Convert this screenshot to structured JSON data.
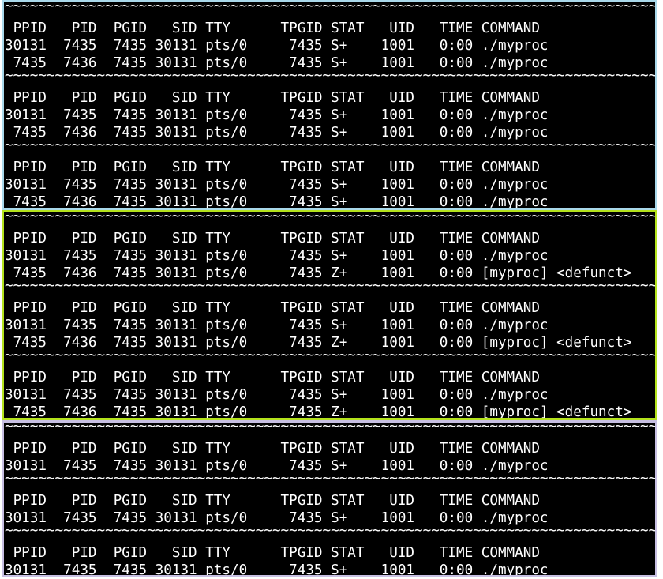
{
  "panels": [
    {
      "name": "running-group",
      "border_color": "#a9d8ea",
      "lines": [
        "~~~~~~~~~~~~~~~~~~~~~~~~~~~~~~~~~~~~~~~~~~~~~~~~~~~~~~~~~~~~~~~~~~~~~~~~~~~~~~~~~",
        " PPID   PID  PGID   SID TTY      TPGID STAT   UID   TIME COMMAND",
        "30131  7435  7435 30131 pts/0     7435 S+    1001   0:00 ./myproc",
        " 7435  7436  7435 30131 pts/0     7435 S+    1001   0:00 ./myproc",
        "~~~~~~~~~~~~~~~~~~~~~~~~~~~~~~~~~~~~~~~~~~~~~~~~~~~~~~~~~~~~~~~~~~~~~~~~~~~~~~~~~",
        " PPID   PID  PGID   SID TTY      TPGID STAT   UID   TIME COMMAND",
        "30131  7435  7435 30131 pts/0     7435 S+    1001   0:00 ./myproc",
        " 7435  7436  7435 30131 pts/0     7435 S+    1001   0:00 ./myproc",
        "~~~~~~~~~~~~~~~~~~~~~~~~~~~~~~~~~~~~~~~~~~~~~~~~~~~~~~~~~~~~~~~~~~~~~~~~~~~~~~~~~",
        " PPID   PID  PGID   SID TTY      TPGID STAT   UID   TIME COMMAND",
        "30131  7435  7435 30131 pts/0     7435 S+    1001   0:00 ./myproc",
        " 7435  7436  7435 30131 pts/0     7435 S+    1001   0:00 ./myproc"
      ]
    },
    {
      "name": "zombie-group",
      "border_color": "#b4e21c",
      "lines": [
        "~~~~~~~~~~~~~~~~~~~~~~~~~~~~~~~~~~~~~~~~~~~~~~~~~~~~~~~~~~~~~~~~~~~~~~~~~~~~~~~~~",
        " PPID   PID  PGID   SID TTY      TPGID STAT   UID   TIME COMMAND",
        "30131  7435  7435 30131 pts/0     7435 S+    1001   0:00 ./myproc",
        " 7435  7436  7435 30131 pts/0     7435 Z+    1001   0:00 [myproc] <defunct>",
        "~~~~~~~~~~~~~~~~~~~~~~~~~~~~~~~~~~~~~~~~~~~~~~~~~~~~~~~~~~~~~~~~~~~~~~~~~~~~~~~~~",
        " PPID   PID  PGID   SID TTY      TPGID STAT   UID   TIME COMMAND",
        "30131  7435  7435 30131 pts/0     7435 S+    1001   0:00 ./myproc",
        " 7435  7436  7435 30131 pts/0     7435 Z+    1001   0:00 [myproc] <defunct>",
        "~~~~~~~~~~~~~~~~~~~~~~~~~~~~~~~~~~~~~~~~~~~~~~~~~~~~~~~~~~~~~~~~~~~~~~~~~~~~~~~~~",
        " PPID   PID  PGID   SID TTY      TPGID STAT   UID   TIME COMMAND",
        "30131  7435  7435 30131 pts/0     7435 S+    1001   0:00 ./myproc",
        " 7435  7436  7435 30131 pts/0     7435 Z+    1001   0:00 [myproc] <defunct>"
      ]
    },
    {
      "name": "reaped-group",
      "border_color": "#c7bfe2",
      "lines": [
        "~~~~~~~~~~~~~~~~~~~~~~~~~~~~~~~~~~~~~~~~~~~~~~~~~~~~~~~~~~~~~~~~~~~~~~~~~~~~~~~~~",
        " PPID   PID  PGID   SID TTY      TPGID STAT   UID   TIME COMMAND",
        "30131  7435  7435 30131 pts/0     7435 S+    1001   0:00 ./myproc",
        "~~~~~~~~~~~~~~~~~~~~~~~~~~~~~~~~~~~~~~~~~~~~~~~~~~~~~~~~~~~~~~~~~~~~~~~~~~~~~~~~~",
        " PPID   PID  PGID   SID TTY      TPGID STAT   UID   TIME COMMAND",
        "30131  7435  7435 30131 pts/0     7435 S+    1001   0:00 ./myproc",
        "~~~~~~~~~~~~~~~~~~~~~~~~~~~~~~~~~~~~~~~~~~~~~~~~~~~~~~~~~~~~~~~~~~~~~~~~~~~~~~~~~",
        " PPID   PID  PGID   SID TTY      TPGID STAT   UID   TIME COMMAND",
        "30131  7435  7435 30131 pts/0     7435 S+    1001   0:00 ./myproc"
      ]
    }
  ]
}
